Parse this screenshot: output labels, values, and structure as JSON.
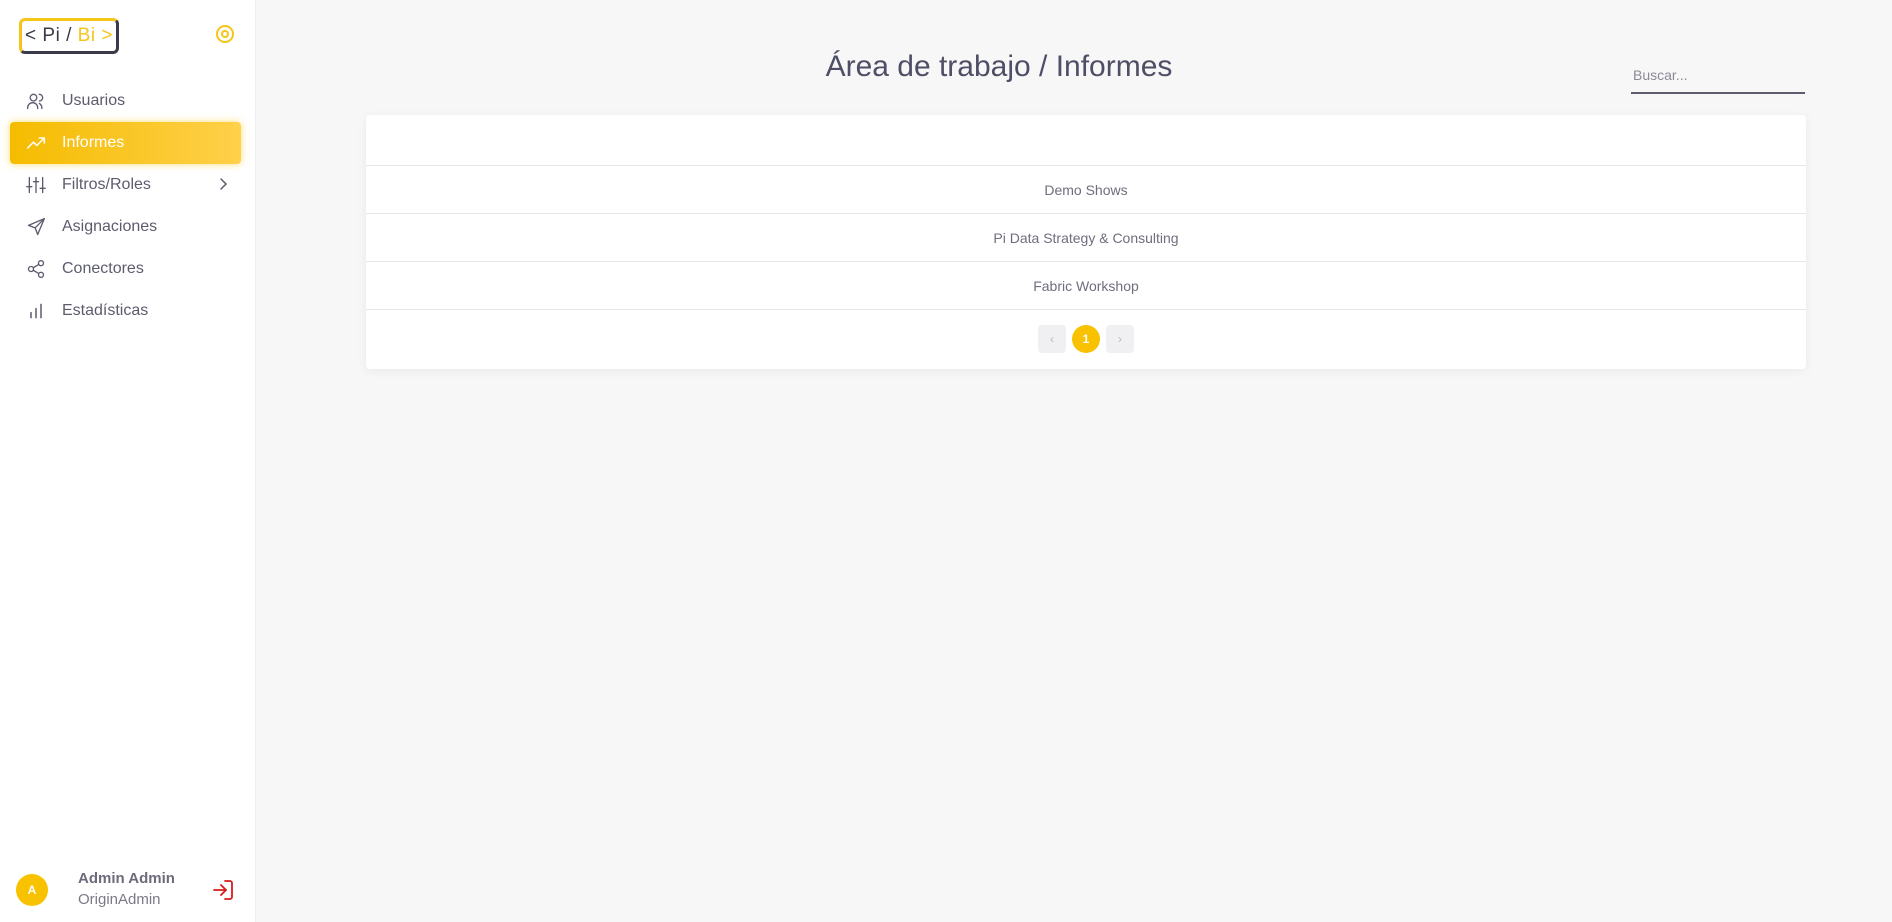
{
  "brand": {
    "left": "< Pi /",
    "right": "Bi >"
  },
  "sidebar": {
    "items": [
      {
        "label": "Usuarios",
        "icon": "users-icon"
      },
      {
        "label": "Informes",
        "icon": "trending-up-icon",
        "active": true
      },
      {
        "label": "Filtros/Roles",
        "icon": "sliders-icon",
        "has_submenu": true
      },
      {
        "label": "Asignaciones",
        "icon": "send-icon"
      },
      {
        "label": "Conectores",
        "icon": "share-icon"
      },
      {
        "label": "Estadísticas",
        "icon": "bar-chart-icon"
      }
    ]
  },
  "user": {
    "initial": "A",
    "name": "Admin Admin",
    "role": "OriginAdmin"
  },
  "header": {
    "title": "Área de trabajo / Informes"
  },
  "search": {
    "placeholder": "Buscar..."
  },
  "reports": {
    "rows": [
      "Demo Shows",
      "Pi Data Strategy & Consulting",
      "Fabric Workshop"
    ]
  },
  "pagination": {
    "prev": "‹",
    "current": "1",
    "next": "›"
  },
  "colors": {
    "accent": "#f8c200",
    "text": "#4e4e66",
    "logout": "#d81b1b"
  }
}
